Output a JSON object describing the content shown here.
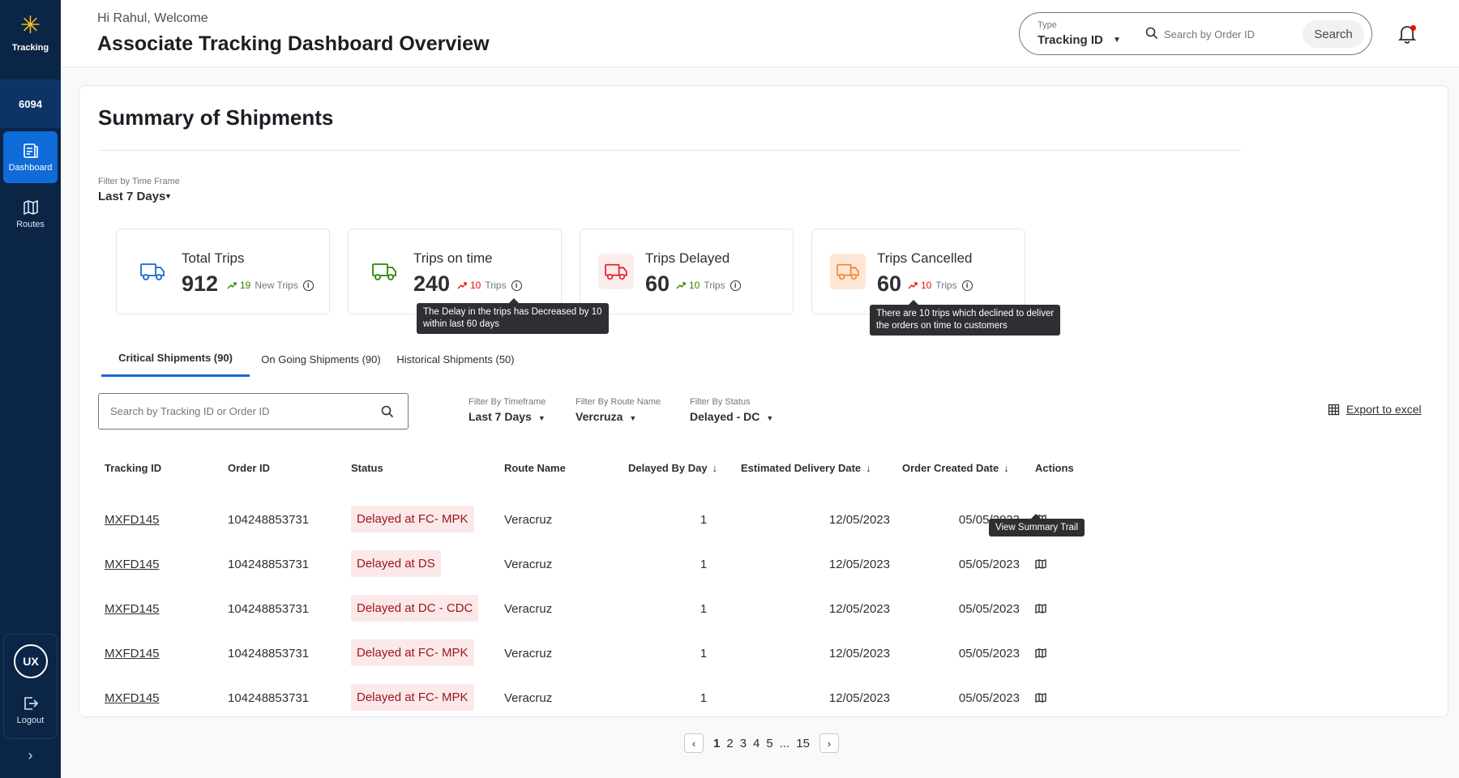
{
  "sidebar": {
    "logo_label": "Tracking",
    "store_number": "6094",
    "items": [
      {
        "label": "Dashboard",
        "icon": "dashboard-icon",
        "active": true
      },
      {
        "label": "Routes",
        "icon": "map-icon",
        "active": false
      }
    ],
    "avatar_initials": "UX",
    "logout_label": "Logout",
    "expand_glyph": "›"
  },
  "header": {
    "welcome": "Hi Rahul, Welcome",
    "title": "Associate Tracking Dashboard Overview",
    "search": {
      "type_caption": "Type",
      "type_value": "Tracking  ID",
      "placeholder": "Search by Order ID",
      "button_label": "Search"
    }
  },
  "summary": {
    "title": "Summary of Shipments",
    "timeframe_caption": "Filter by  Time Frame",
    "timeframe_value": "Last 7 Days",
    "cards": [
      {
        "title": "Total Trips",
        "value": "912",
        "trend_num": "19",
        "trend_text": "New Trips",
        "color": "#0f6bd7",
        "bg": "#ffffff",
        "trend_color": "#2a8703"
      },
      {
        "title": "Trips on time",
        "value": "240",
        "trend_num": "10",
        "trend_text": "Trips",
        "color": "#2a8703",
        "bg": "#ffffff",
        "trend_color": "#ea1100"
      },
      {
        "title": "Trips Delayed",
        "value": "60",
        "trend_num": "10",
        "trend_text": "Trips",
        "color": "#de1c24",
        "bg": "#fdecec",
        "trend_color": "#2a8703"
      },
      {
        "title": "Trips Cancelled",
        "value": "60",
        "trend_num": "10",
        "trend_text": "Trips",
        "color": "#f2832b",
        "bg": "#fde6d6",
        "trend_color": "#ea1100"
      }
    ],
    "tooltips": {
      "on_time_line1": "The Delay in the trips has Decreased by 10",
      "on_time_line2": "within last 60 days",
      "cancelled_line1": "There are 10 trips which declined to deliver",
      "cancelled_line2": "the orders on time to customers"
    }
  },
  "tabs": [
    {
      "label": "Critical Shipments (90)",
      "active": true
    },
    {
      "label": "On Going Shipments  (90)",
      "active": false
    },
    {
      "label": "Historical Shipments (50)",
      "active": false
    }
  ],
  "table_search_placeholder": "Search by Tracking ID or Order ID",
  "filters": [
    {
      "caption": "Filter By Timeframe",
      "value": "Last 7 Days"
    },
    {
      "caption": "Filter By Route Name",
      "value": "Vercruza"
    },
    {
      "caption": "Filter By Status",
      "value": "Delayed - DC"
    }
  ],
  "export_label": "Export to excel",
  "table": {
    "headers": [
      "Tracking ID",
      "Order ID",
      "Status",
      "Route Name",
      "Delayed By Day",
      "Estimated Delivery Date",
      "Order Created Date",
      "Actions"
    ],
    "rows": [
      {
        "tracking_id": "MXFD145",
        "order_id": "104248853731",
        "status": "Delayed at FC- MPK",
        "route": "Veracruz",
        "delayed": "1",
        "est_date": "12/05/2023",
        "created": "05/05/2023"
      },
      {
        "tracking_id": "MXFD145",
        "order_id": "104248853731",
        "status": "Delayed at DS",
        "route": "Veracruz",
        "delayed": "1",
        "est_date": "12/05/2023",
        "created": "05/05/2023"
      },
      {
        "tracking_id": "MXFD145",
        "order_id": "104248853731",
        "status": "Delayed at DC - CDC",
        "route": "Veracruz",
        "delayed": "1",
        "est_date": "12/05/2023",
        "created": "05/05/2023"
      },
      {
        "tracking_id": "MXFD145",
        "order_id": "104248853731",
        "status": "Delayed at FC- MPK",
        "route": "Veracruz",
        "delayed": "1",
        "est_date": "12/05/2023",
        "created": "05/05/2023"
      },
      {
        "tracking_id": "MXFD145",
        "order_id": "104248853731",
        "status": "Delayed at FC- MPK",
        "route": "Veracruz",
        "delayed": "1",
        "est_date": "12/05/2023",
        "created": "05/05/2023"
      }
    ],
    "action_tooltip": "View Summary Trail"
  },
  "pagination": {
    "pages": [
      "1",
      "2",
      "3",
      "4",
      "5",
      "...",
      "15"
    ],
    "current": "1"
  }
}
